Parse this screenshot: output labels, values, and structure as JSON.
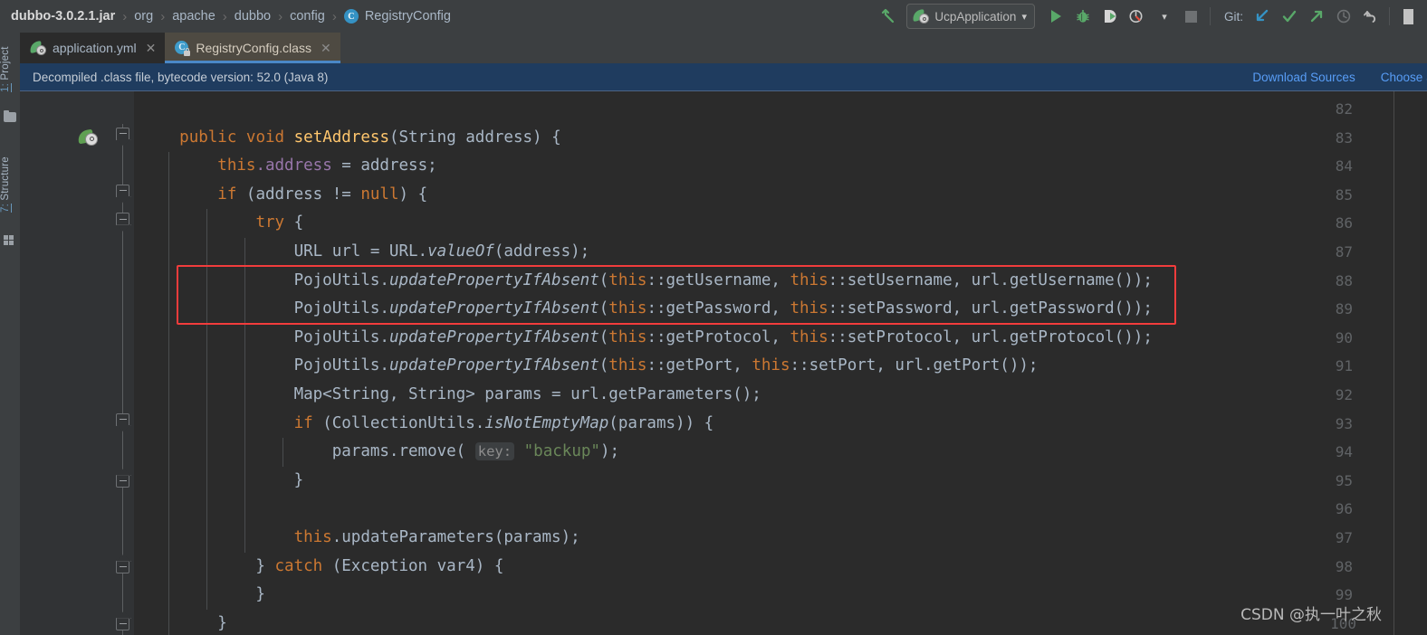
{
  "toolbar": {
    "breadcrumbs": [
      {
        "label": "dubbo-3.0.2.1.jar",
        "type": "jar"
      },
      {
        "label": "org",
        "type": "pkg"
      },
      {
        "label": "apache",
        "type": "pkg"
      },
      {
        "label": "dubbo",
        "type": "pkg"
      },
      {
        "label": "config",
        "type": "pkg"
      },
      {
        "label": "RegistryConfig",
        "type": "class"
      }
    ],
    "separator": "›",
    "class_icon_letter": "C",
    "back_arrow_icon": "back-arrow-icon",
    "run_config": {
      "label": "UcpApplication",
      "icon": "spring-boot-icon",
      "chevron": "▾"
    },
    "actions": [
      {
        "name": "run-button",
        "icon": "play-icon"
      },
      {
        "name": "debug-button",
        "icon": "bug-icon"
      },
      {
        "name": "run-with-coverage-button",
        "icon": "coverage-icon"
      },
      {
        "name": "profile-button",
        "icon": "profiler-icon"
      },
      {
        "name": "stop-button",
        "icon": "stop-icon"
      }
    ],
    "git_label": "Git:",
    "git_actions": [
      {
        "name": "git-update-project-button",
        "icon": "arrow-down-left-icon"
      },
      {
        "name": "git-commit-button",
        "icon": "check-icon"
      },
      {
        "name": "git-push-button",
        "icon": "arrow-up-right-icon"
      },
      {
        "name": "git-history-button",
        "icon": "clock-icon"
      },
      {
        "name": "git-rollback-button",
        "icon": "undo-icon"
      }
    ],
    "search_icon": "search-icon"
  },
  "left_strip": {
    "project_tab": {
      "num": "1:",
      "label": " Project",
      "icon": "folder-icon"
    },
    "structure_tab": {
      "num": "7:",
      "label": " Structure",
      "icon": "structure-grid-icon"
    }
  },
  "tabs": [
    {
      "label": "application.yml",
      "icon": "spring-yaml-icon",
      "close": "✕",
      "active": false
    },
    {
      "label": "RegistryConfig.class",
      "icon": "class-locked-icon",
      "close": "✕",
      "active": true
    }
  ],
  "notification": {
    "message": "Decompiled .class file, bytecode version: 52.0 (Java 8)",
    "download_sources": "Download Sources",
    "choose_sources": "Choose S"
  },
  "editor": {
    "first_line": 82,
    "last_line": 100,
    "gutter_bean_icon_line": 83,
    "red_highlight_lines": [
      88,
      89
    ],
    "lines": [
      {
        "n": 82,
        "tokens": []
      },
      {
        "n": 83,
        "fold": "open",
        "bean": true,
        "indents": [],
        "tokens": [
          {
            "t": "    ",
            "c": "pln"
          },
          {
            "t": "public",
            "c": "kw"
          },
          {
            "t": " ",
            "c": "pln"
          },
          {
            "t": "void",
            "c": "kw"
          },
          {
            "t": " ",
            "c": "pln"
          },
          {
            "t": "setAddress",
            "c": "mth"
          },
          {
            "t": "(String address) {",
            "c": "pln"
          }
        ]
      },
      {
        "n": 84,
        "indents": [
          1
        ],
        "tokens": [
          {
            "t": "        ",
            "c": "pln"
          },
          {
            "t": "this",
            "c": "kw"
          },
          {
            "t": ".address",
            "c": "fld"
          },
          {
            "t": " = address;",
            "c": "pln"
          }
        ]
      },
      {
        "n": 85,
        "fold": "open",
        "indents": [
          1
        ],
        "tokens": [
          {
            "t": "        ",
            "c": "pln"
          },
          {
            "t": "if",
            "c": "kw"
          },
          {
            "t": " (address != ",
            "c": "pln"
          },
          {
            "t": "null",
            "c": "kw"
          },
          {
            "t": ") {",
            "c": "pln"
          }
        ]
      },
      {
        "n": 86,
        "fold": "open",
        "indents": [
          1,
          2
        ],
        "tokens": [
          {
            "t": "            ",
            "c": "pln"
          },
          {
            "t": "try",
            "c": "kw"
          },
          {
            "t": " {",
            "c": "pln"
          }
        ]
      },
      {
        "n": 87,
        "indents": [
          1,
          2,
          3
        ],
        "tokens": [
          {
            "t": "                URL url = URL.",
            "c": "pln"
          },
          {
            "t": "valueOf",
            "c": "stat"
          },
          {
            "t": "(address);",
            "c": "pln"
          }
        ]
      },
      {
        "n": 88,
        "indents": [
          1,
          2,
          3
        ],
        "tokens": [
          {
            "t": "                PojoUtils.",
            "c": "pln"
          },
          {
            "t": "updatePropertyIfAbsent",
            "c": "stat"
          },
          {
            "t": "(",
            "c": "pln"
          },
          {
            "t": "this",
            "c": "kw"
          },
          {
            "t": "::getUsername, ",
            "c": "pln"
          },
          {
            "t": "this",
            "c": "kw"
          },
          {
            "t": "::setUsername, url.getUsername());",
            "c": "pln"
          }
        ]
      },
      {
        "n": 89,
        "indents": [
          1,
          2,
          3
        ],
        "tokens": [
          {
            "t": "                PojoUtils.",
            "c": "pln"
          },
          {
            "t": "updatePropertyIfAbsent",
            "c": "stat"
          },
          {
            "t": "(",
            "c": "pln"
          },
          {
            "t": "this",
            "c": "kw"
          },
          {
            "t": "::getPassword, ",
            "c": "pln"
          },
          {
            "t": "this",
            "c": "kw"
          },
          {
            "t": "::setPassword, url.getPassword());",
            "c": "pln"
          }
        ]
      },
      {
        "n": 90,
        "indents": [
          1,
          2,
          3
        ],
        "tokens": [
          {
            "t": "                PojoUtils.",
            "c": "pln"
          },
          {
            "t": "updatePropertyIfAbsent",
            "c": "stat"
          },
          {
            "t": "(",
            "c": "pln"
          },
          {
            "t": "this",
            "c": "kw"
          },
          {
            "t": "::getProtocol, ",
            "c": "pln"
          },
          {
            "t": "this",
            "c": "kw"
          },
          {
            "t": "::setProtocol, url.getProtocol());",
            "c": "pln"
          }
        ]
      },
      {
        "n": 91,
        "indents": [
          1,
          2,
          3
        ],
        "tokens": [
          {
            "t": "                PojoUtils.",
            "c": "pln"
          },
          {
            "t": "updatePropertyIfAbsent",
            "c": "stat"
          },
          {
            "t": "(",
            "c": "pln"
          },
          {
            "t": "this",
            "c": "kw"
          },
          {
            "t": "::getPort, ",
            "c": "pln"
          },
          {
            "t": "this",
            "c": "kw"
          },
          {
            "t": "::setPort, url.getPort());",
            "c": "pln"
          }
        ]
      },
      {
        "n": 92,
        "indents": [
          1,
          2,
          3
        ],
        "tokens": [
          {
            "t": "                Map<String, String> params = url.getParameters();",
            "c": "pln"
          }
        ]
      },
      {
        "n": 93,
        "fold": "open",
        "indents": [
          1,
          2,
          3
        ],
        "tokens": [
          {
            "t": "                ",
            "c": "pln"
          },
          {
            "t": "if",
            "c": "kw"
          },
          {
            "t": " (CollectionUtils.",
            "c": "pln"
          },
          {
            "t": "isNotEmptyMap",
            "c": "stat"
          },
          {
            "t": "(params)) {",
            "c": "pln"
          }
        ]
      },
      {
        "n": 94,
        "indents": [
          1,
          2,
          3,
          4
        ],
        "tokens": [
          {
            "t": "                    params.remove( ",
            "c": "pln"
          },
          {
            "t": "key:",
            "c": "hint"
          },
          {
            "t": " ",
            "c": "pln"
          },
          {
            "t": "\"backup\"",
            "c": "str"
          },
          {
            "t": ");",
            "c": "pln"
          }
        ]
      },
      {
        "n": 95,
        "fold": "close",
        "indents": [
          1,
          2,
          3
        ],
        "tokens": [
          {
            "t": "                }",
            "c": "pln"
          }
        ]
      },
      {
        "n": 96,
        "indents": [
          1,
          2,
          3
        ],
        "tokens": []
      },
      {
        "n": 97,
        "indents": [
          1,
          2,
          3
        ],
        "tokens": [
          {
            "t": "                ",
            "c": "pln"
          },
          {
            "t": "this",
            "c": "kw"
          },
          {
            "t": ".updateParameters(params);",
            "c": "pln"
          }
        ]
      },
      {
        "n": 98,
        "fold": "close",
        "indents": [
          1,
          2
        ],
        "tokens": [
          {
            "t": "            } ",
            "c": "pln"
          },
          {
            "t": "catch",
            "c": "kw"
          },
          {
            "t": " (Exception var4) {",
            "c": "pln"
          }
        ]
      },
      {
        "n": 99,
        "indents": [
          1,
          2
        ],
        "tokens": [
          {
            "t": "            }",
            "c": "pln"
          }
        ]
      },
      {
        "n": 100,
        "fold": "close",
        "indents": [
          1
        ],
        "tokens": [
          {
            "t": "        }",
            "c": "pln"
          }
        ]
      }
    ]
  },
  "watermark": "CSDN @执一叶之秋",
  "colors": {
    "editor_bg": "#2b2b2b",
    "gutter_bg": "#313335",
    "chrome_bg": "#3c3f41",
    "active_tab_bg": "#4e4a42",
    "active_tab_underline": "#4a88c7",
    "notification_bg": "#1f3c5f",
    "link": "#589df6",
    "keyword": "#cc7832",
    "method": "#ffc66d",
    "field": "#9876aa",
    "string": "#6a8759",
    "default_text": "#a9b7c6",
    "line_number": "#606366",
    "red_box": "#f23c3c",
    "green_run": "#59a869"
  }
}
